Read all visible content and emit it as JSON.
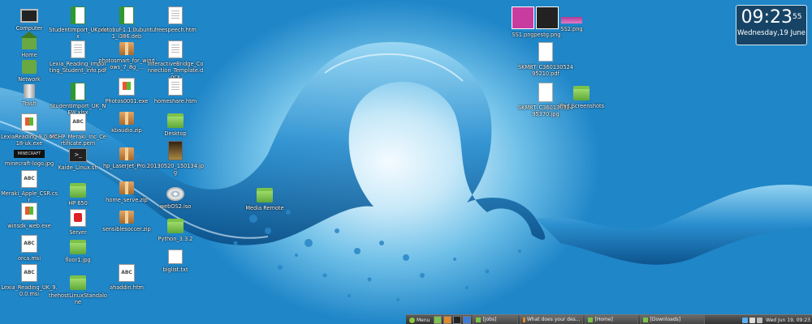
{
  "clock_widget": {
    "hours": "09",
    "minutes": "23",
    "seconds": "55",
    "date": "Wednesday,19 June"
  },
  "desktop_icons": [
    {
      "label": "Computer",
      "icon": "computer-icon"
    },
    {
      "label": "Home",
      "icon": "home-folder-icon"
    },
    {
      "label": "Network",
      "icon": "network-icon"
    },
    {
      "label": "Trash",
      "icon": "trash-icon"
    },
    {
      "label": "LexiaReading-9.0.0-b18-uk.exe",
      "icon": "windows-exe-icon"
    },
    {
      "label": "minecraft-logo.jpg",
      "icon": "image-icon"
    },
    {
      "label": "Meraki_Apple_CSR.csr",
      "icon": "text-file-icon"
    },
    {
      "label": "winsdk_web.exe",
      "icon": "windows-exe-icon"
    },
    {
      "label": "orca.msi",
      "icon": "text-file-icon"
    },
    {
      "label": "Lexia_Reading_UK_9.0.0.msi",
      "icon": "text-file-icon"
    },
    {
      "label": "StudentImport_UK.xlsx",
      "icon": "spreadsheet-icon"
    },
    {
      "label": "Lexia_Reading_Importing_Student_Info.pdf",
      "icon": "document-icon"
    },
    {
      "label": "StudentImport_UK_NEW.xlsx",
      "icon": "spreadsheet-icon"
    },
    {
      "label": "MCHP_Meraki_Inc_Certificate.pem",
      "icon": "text-file-icon"
    },
    {
      "label": "Kaide_Linux.sh",
      "icon": "terminal-script-icon"
    },
    {
      "label": "HP 650",
      "icon": "folder-icon"
    },
    {
      "label": "Server",
      "icon": "pdf-icon"
    },
    {
      "label": "floor1.jpg",
      "icon": "folder-icon"
    },
    {
      "label": "thehostLinuxStandalone",
      "icon": "folder-icon"
    },
    {
      "label": "protobuf-1.1.0ubuntu1_i386.deb",
      "icon": "spreadsheet-icon"
    },
    {
      "label": "photosmart_for_windows_7_8g_...",
      "icon": "archive-icon"
    },
    {
      "label": "Photos0001.exe",
      "icon": "windows-exe-icon"
    },
    {
      "label": "kbaudio.zip",
      "icon": "archive-icon"
    },
    {
      "label": "hp_LaserJet_Pro...",
      "icon": "archive-icon"
    },
    {
      "label": "home_serve.zip",
      "icon": "archive-icon"
    },
    {
      "label": "sensiblesoccer.zip",
      "icon": "archive-icon"
    },
    {
      "label": "ahaddin.htm",
      "icon": "text-file-icon"
    },
    {
      "label": "freespeech.htm",
      "icon": "html-file-icon"
    },
    {
      "label": "InteractiveBridge_Connection_Template.docx",
      "icon": "html-file-icon"
    },
    {
      "label": "homeshare.htm",
      "icon": "html-file-icon"
    },
    {
      "label": "Desktop",
      "icon": "folder-icon"
    },
    {
      "label": "20130520_150134.jpg",
      "icon": "photo-icon"
    },
    {
      "label": "webOS2.iso",
      "icon": "disc-icon"
    },
    {
      "label": "Python_3.3.2",
      "icon": "folder-icon"
    },
    {
      "label": "biglist.txt",
      "icon": "book-icon"
    },
    {
      "label": "Media Remote",
      "icon": "folder-icon"
    },
    {
      "label": "SS1.png",
      "icon": "pink-image-icon"
    },
    {
      "label": "pestg.png",
      "icon": "dark-image-icon"
    },
    {
      "label": "SS2.png",
      "icon": "pink-strip-image-icon"
    },
    {
      "label": "SKM8T_C36013052495210.pdf",
      "icon": "page-icon"
    },
    {
      "label": "SKM8T_C36013052495370.jpg",
      "icon": "page-icon"
    },
    {
      "label": "iPad Screenshots",
      "icon": "folder-icon"
    }
  ],
  "panel": {
    "menu_label": "Menu",
    "tasks": [
      {
        "label": "[jobs]",
        "icon": "folder-icon"
      },
      {
        "label": "What does your des...",
        "icon": "browser-icon"
      },
      {
        "label": "[Home]",
        "icon": "folder-icon"
      },
      {
        "label": "[Downloads]",
        "icon": "folder-icon"
      }
    ],
    "clock": "Wed Jun 19, 09:23"
  },
  "colors": {
    "sky": "#1f86c8",
    "water": "#0f5f9e",
    "folder": "#7bc24a",
    "panel": "#3a3a3a"
  }
}
